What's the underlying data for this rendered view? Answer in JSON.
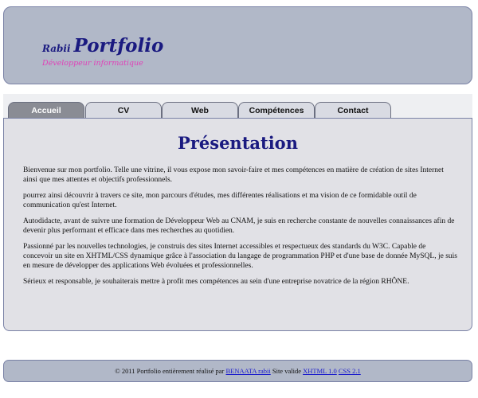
{
  "header": {
    "brand_first": "Rabii",
    "brand_second": "Portfolio",
    "tagline": "Développeur informatique"
  },
  "tabs": [
    {
      "label": "Accueil",
      "active": true
    },
    {
      "label": "CV",
      "active": false
    },
    {
      "label": "Web",
      "active": false
    },
    {
      "label": "Compétences",
      "active": false
    },
    {
      "label": "Contact",
      "active": false
    }
  ],
  "main": {
    "title": "Présentation",
    "paragraphs": [
      "Bienvenue sur mon portfolio. Telle une vitrine, il vous expose mon savoir-faire et mes compétences en matière de création de sites Internet ainsi que mes attentes et objectifs professionnels.",
      "pourrez ainsi découvrir à travers ce site, mon parcours d'études, mes différentes réalisations et ma vision de ce formidable outil de communication qu'est Internet.",
      "Autodidacte, avant de suivre une formation de Développeur Web au CNAM, je suis en recherche constante de nouvelles connaissances afin de devenir plus performant et efficace dans mes recherches au quotidien.",
      "Passionné par les nouvelles technologies, je construis des sites Internet accessibles et respectueux des standards du W3C. Capable de concevoir un site en XHTML/CSS dynamique grâce à l'association du langage de programmation PHP et d'une base de donnée MySQL, je suis en mesure de développer des applications Web évoluées et professionnelles.",
      "Sérieux et responsable, je souhaiterais mettre à profit mes compétences au sein d'une entreprise novatrice de la région RHÔNE."
    ]
  },
  "footer": {
    "text_before": "© 2011 Portfolio entièrement réalisé par",
    "author_link": "BENAATA rabii",
    "text_middle": "Site valide",
    "xhtml_link": "XHTML 1.0",
    "css_link": "CSS 2.1"
  },
  "colors": {
    "header_bg": "#b1b8c8",
    "title_color": "#1a1a80",
    "tagline_color": "#e040b8",
    "content_bg": "#e1e1e6",
    "active_tab_bg": "#8a8c94",
    "link_color": "#1a1acc"
  }
}
